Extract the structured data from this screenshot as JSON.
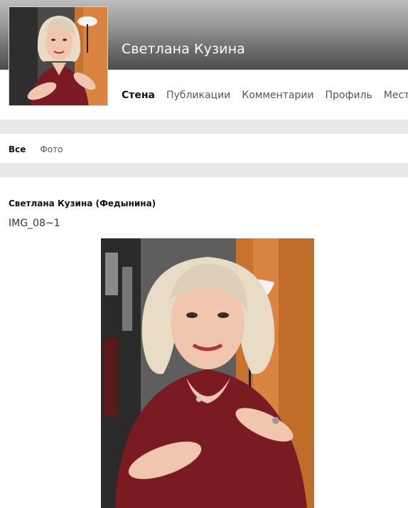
{
  "profile": {
    "name": "Светлана Кузина"
  },
  "nav": {
    "tabs": [
      {
        "label": "Стена",
        "active": true
      },
      {
        "label": "Публикации",
        "active": false
      },
      {
        "label": "Комментарии",
        "active": false
      },
      {
        "label": "Профиль",
        "active": false
      },
      {
        "label": "Места",
        "active": false
      }
    ]
  },
  "filters": {
    "tabs": [
      {
        "label": "Все",
        "active": true
      },
      {
        "label": "Фото",
        "active": false
      }
    ]
  },
  "post": {
    "author": "Светлана Кузина (Федынина)",
    "caption": "IMG_08~1"
  },
  "colors": {
    "header_top": "#bdbdbd",
    "header_bottom": "#4d4d4d",
    "divider": "#e8e8e8",
    "wall_orange": "#c8722e",
    "dress": "#7a1a22",
    "hair": "#e9dcc6"
  }
}
